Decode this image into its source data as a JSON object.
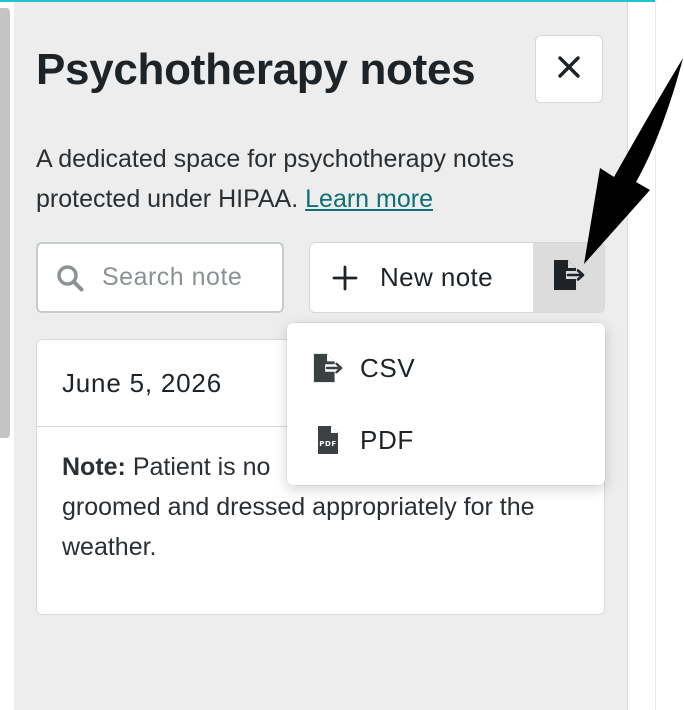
{
  "panel": {
    "title": "Psychotherapy notes",
    "close_label": "×",
    "description": "A dedicated space for psychotherapy notes protected under HIPAA.",
    "learn_more": "Learn more"
  },
  "toolbar": {
    "search_placeholder": "Search note",
    "search_value": "",
    "new_note_label": "New note"
  },
  "export_menu": {
    "items": [
      {
        "label": "CSV",
        "icon": "file-export-icon"
      },
      {
        "label": "PDF",
        "icon": "pdf-file-icon"
      }
    ]
  },
  "note": {
    "date": "June 5, 2026",
    "body_label": "Note:",
    "body_text": "Patient is no",
    "body_text_2": "groomed and dressed appropriately for the weather."
  },
  "colors": {
    "accent": "#22c1d0",
    "link": "#0d7074",
    "panel_bg": "#ededed",
    "export_button_bg": "#dcdcdc",
    "arrow_annotation": "#000000"
  }
}
